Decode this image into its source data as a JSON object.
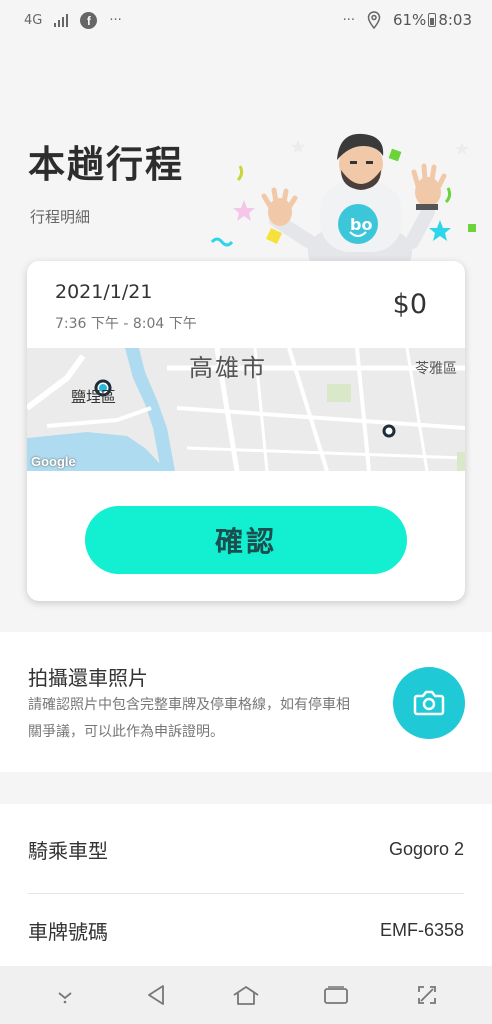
{
  "status_bar": {
    "network": "4G",
    "overflow": "···",
    "overflow_right": "···",
    "battery": "61%",
    "time": "8:03"
  },
  "header": {
    "title": "本趟行程",
    "subtitle": "行程明細"
  },
  "trip": {
    "date": "2021/1/21",
    "time_range": "7:36 下午 - 8:04 下午",
    "price": "$0",
    "map": {
      "city_label": "高雄市",
      "district_right": "苓雅區",
      "district_left": "鹽埕區",
      "attribution": "Google"
    },
    "confirm_label": "確認"
  },
  "photo": {
    "title": "拍攝還車照片",
    "description": "請確認照片中包含完整車牌及停車格線，如有停車相關爭議，可以此作為申訴證明。"
  },
  "details": {
    "rows": [
      {
        "label": "騎乘車型",
        "value": "Gogoro 2"
      },
      {
        "label": "車牌號碼",
        "value": "EMF-6358"
      }
    ]
  },
  "colors": {
    "accent": "#12efd1",
    "camera": "#1fc9d6",
    "background": "#f5f5f5"
  }
}
